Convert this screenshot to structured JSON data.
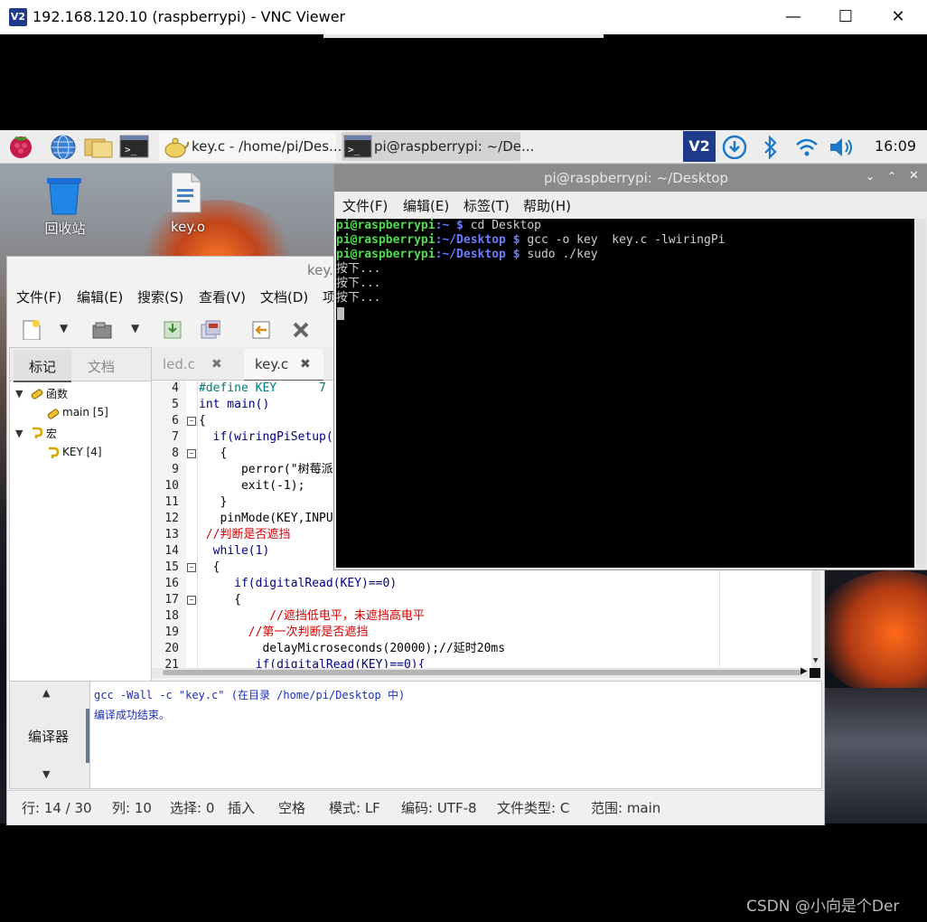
{
  "vnc": {
    "title": "192.168.120.10 (raspberrypi) - VNC Viewer",
    "logo": "V2",
    "minimize": "—",
    "maximize": "☐",
    "close": "✕"
  },
  "panel": {
    "tasks": [
      {
        "label": "key.c - /home/pi/Des..."
      },
      {
        "label": "pi@raspberrypi: ~/De..."
      }
    ],
    "clock": "16:09",
    "vnc_tray": "V2"
  },
  "desktop": {
    "icons": [
      {
        "label": "回收站",
        "icon": "trash-icon"
      },
      {
        "label": "key.o",
        "icon": "file-icon"
      }
    ]
  },
  "geany": {
    "title": "key.",
    "menu": [
      "文件(F)",
      "编辑(E)",
      "搜索(S)",
      "查看(V)",
      "文档(D)",
      "项"
    ],
    "sidebar_tabs": [
      "标记",
      "文档"
    ],
    "tree": [
      {
        "label": "函数",
        "level": 0
      },
      {
        "label": "main [5]",
        "level": 1
      },
      {
        "label": "宏",
        "level": 0
      },
      {
        "label": "KEY [4]",
        "level": 1
      }
    ],
    "tabs": [
      {
        "label": "led.c",
        "close": "✖"
      },
      {
        "label": "key.c",
        "close": "✖"
      }
    ],
    "line_numbers": [
      "4",
      "5",
      "6",
      "7",
      "8",
      "9",
      "10",
      "11",
      "12",
      "13",
      "14",
      "15",
      "16",
      "17",
      "18",
      "19",
      "20",
      "21"
    ],
    "code": [
      {
        "indent": "",
        "text": "#define KEY      7",
        "kind": "define"
      },
      {
        "indent": "",
        "text": "int main()",
        "kind": "normal"
      },
      {
        "indent": "",
        "text": "{",
        "kind": "normal"
      },
      {
        "indent": "  ",
        "text": "if(wiringPiSetup(",
        "kind": "normal"
      },
      {
        "indent": "   ",
        "text": "{",
        "kind": "normal"
      },
      {
        "indent": "      ",
        "text": "perror(\"树莓派",
        "kind": "normal"
      },
      {
        "indent": "      ",
        "text": "exit(-1);",
        "kind": "normal"
      },
      {
        "indent": "   ",
        "text": "}",
        "kind": "normal"
      },
      {
        "indent": "   ",
        "text": "pinMode(KEY,INPU",
        "kind": "normal"
      },
      {
        "indent": " ",
        "text": "//判断是否遮挡",
        "kind": "comment"
      },
      {
        "indent": "  ",
        "text": "while(1)",
        "kind": "normal"
      },
      {
        "indent": "  ",
        "text": "{",
        "kind": "normal"
      },
      {
        "indent": "     ",
        "text": "if(digitalRead(KEY)==0)",
        "kind": "normal"
      },
      {
        "indent": "     ",
        "text": "{",
        "kind": "normal"
      },
      {
        "indent": "          ",
        "text": "//遮挡低电平，未遮挡高电平",
        "kind": "comment"
      },
      {
        "indent": "       ",
        "text": "//第一次判断是否遮挡",
        "kind": "comment"
      },
      {
        "indent": "         ",
        "text": "delayMicroseconds(20000);//延时20ms",
        "kind": "normal"
      },
      {
        "indent": "        ",
        "text": "if(digitalRead(KEY)==0){",
        "kind": "normal"
      }
    ],
    "msg_side_label": "编译器",
    "messages": [
      "gcc -Wall -c \"key.c\" (在目录 /home/pi/Desktop 中)",
      "编译成功结束。"
    ],
    "status": [
      "行: 14 / 30",
      "列: 10",
      "选择: 0",
      "插入",
      "空格",
      "模式: LF",
      "编码: UTF-8",
      "文件类型: C",
      "范围: main"
    ]
  },
  "terminal": {
    "title": "pi@raspberrypi: ~/Desktop",
    "menu": [
      "文件(F)",
      "编辑(E)",
      "标签(T)",
      "帮助(H)"
    ],
    "lines": [
      {
        "user": "pi@raspberrypi",
        "path": ":~ $",
        "cmd": " cd Desktop"
      },
      {
        "user": "pi@raspberrypi",
        "path": ":~/Desktop $",
        "cmd": " gcc -o key  key.c -lwiringPi"
      },
      {
        "user": "pi@raspberrypi",
        "path": ":~/Desktop $",
        "cmd": " sudo ./key"
      }
    ],
    "output": [
      "按下...",
      "按下...",
      "按下..."
    ]
  },
  "watermark": "CSDN @小向是个Der",
  "colors": {
    "terminal_user": "#4fdc4f",
    "terminal_path": "#6a7cff",
    "comment": "#d40000",
    "keyword": "#00007f"
  }
}
